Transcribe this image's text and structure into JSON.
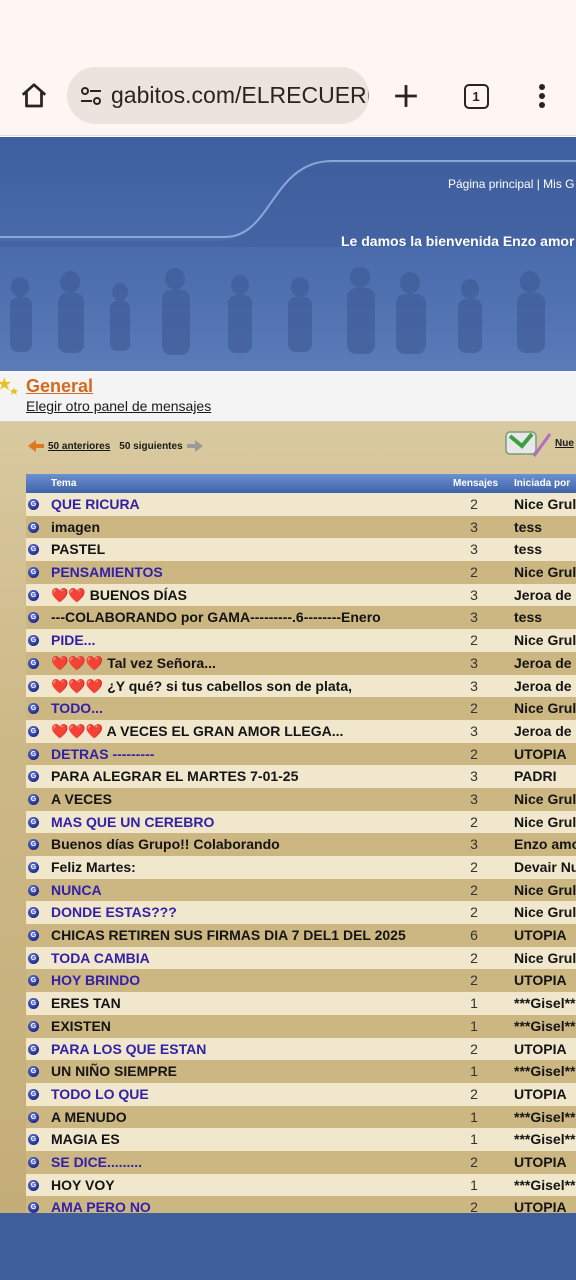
{
  "browser": {
    "url": "gabitos.com/ELRECUERDO",
    "tab_count": "1"
  },
  "site": {
    "nav_links": "Página principal  |  Mis G",
    "welcome": "Le damos la bienvenida Enzo amor d"
  },
  "board": {
    "title": "General",
    "choose_other": "Elegir otro panel de mensajes",
    "prev_label": "50 anteriores",
    "next_label": "50 siguientes",
    "new_topic_label": "Nue"
  },
  "table": {
    "headers": {
      "topic": "Tema",
      "messages": "Mensajes",
      "started_by": "Iniciada por"
    },
    "rows": [
      {
        "hearts": "",
        "title": "QUE RICURA",
        "count": "2",
        "author": "Nice Grull",
        "link": true
      },
      {
        "hearts": "",
        "title": "imagen",
        "count": "3",
        "author": "tess",
        "link": false
      },
      {
        "hearts": "",
        "title": "PASTEL",
        "count": "3",
        "author": "tess",
        "link": false
      },
      {
        "hearts": "",
        "title": "PENSAMIENTOS",
        "count": "2",
        "author": "Nice Grull",
        "link": true
      },
      {
        "hearts": "❤️❤️",
        "title": "BUENOS DÍAS",
        "count": "3",
        "author": "Jeroa de l",
        "link": false
      },
      {
        "hearts": "",
        "title": "---COLABORANDO por GAMA---------.6--------Enero",
        "count": "3",
        "author": "tess",
        "link": false
      },
      {
        "hearts": "",
        "title": "PIDE...",
        "count": "2",
        "author": "Nice Grull",
        "link": true
      },
      {
        "hearts": "❤️❤️❤️",
        "title": "Tal vez Señora...",
        "count": "3",
        "author": "Jeroa de l",
        "link": false
      },
      {
        "hearts": "❤️❤️❤️",
        "title": "¿Y qué? si tus cabellos son de plata,",
        "count": "3",
        "author": "Jeroa de l",
        "link": false
      },
      {
        "hearts": "",
        "title": "TODO...",
        "count": "2",
        "author": "Nice Grull",
        "link": true
      },
      {
        "hearts": "❤️❤️❤️",
        "title": "A VECES EL GRAN AMOR LLEGA...",
        "count": "3",
        "author": "Jeroa de l",
        "link": false
      },
      {
        "hearts": "",
        "title": "DETRAS ---------",
        "count": "2",
        "author": "UTOPIA",
        "link": true
      },
      {
        "hearts": "",
        "title": "PARA ALEGRAR EL MARTES 7-01-25",
        "count": "3",
        "author": "PADRI",
        "link": false
      },
      {
        "hearts": "",
        "title": "A VECES",
        "count": "3",
        "author": "Nice Grull",
        "link": false
      },
      {
        "hearts": "",
        "title": "MAS QUE UN CEREBRO",
        "count": "2",
        "author": "Nice Grull",
        "link": true
      },
      {
        "hearts": "",
        "title": "Buenos días Grupo!! Colaborando",
        "count": "3",
        "author": "Enzo amo",
        "link": false
      },
      {
        "hearts": "",
        "title": "Feliz Martes:",
        "count": "2",
        "author": "Devair Nu",
        "link": false
      },
      {
        "hearts": "",
        "title": "NUNCA",
        "count": "2",
        "author": "Nice Grull",
        "link": true
      },
      {
        "hearts": "",
        "title": "DONDE ESTAS???",
        "count": "2",
        "author": "Nice Grull",
        "link": true
      },
      {
        "hearts": "",
        "title": "CHICAS RETIREN SUS FIRMAS DIA 7 DEL1 DEL 2025",
        "count": "6",
        "author": "UTOPIA",
        "link": false
      },
      {
        "hearts": "",
        "title": "TODA CAMBIA",
        "count": "2",
        "author": "Nice Grull",
        "link": true
      },
      {
        "hearts": "",
        "title": "HOY BRINDO",
        "count": "2",
        "author": "UTOPIA",
        "link": true
      },
      {
        "hearts": "",
        "title": "ERES TAN",
        "count": "1",
        "author": "***Gisel**",
        "link": false
      },
      {
        "hearts": "",
        "title": "EXISTEN",
        "count": "1",
        "author": "***Gisel**",
        "link": false
      },
      {
        "hearts": "",
        "title": "PARA LOS QUE ESTAN",
        "count": "2",
        "author": "UTOPIA",
        "link": true
      },
      {
        "hearts": "",
        "title": "UN NIÑO SIEMPRE",
        "count": "1",
        "author": "***Gisel**",
        "link": false
      },
      {
        "hearts": "",
        "title": "TODO LO QUE",
        "count": "2",
        "author": "UTOPIA",
        "link": true
      },
      {
        "hearts": "",
        "title": "A MENUDO",
        "count": "1",
        "author": "***Gisel**",
        "link": false
      },
      {
        "hearts": "",
        "title": "MAGIA ES",
        "count": "1",
        "author": "***Gisel**",
        "link": false
      },
      {
        "hearts": "",
        "title": "SE DICE.........",
        "count": "2",
        "author": "UTOPIA",
        "link": true
      },
      {
        "hearts": "",
        "title": "HOY VOY",
        "count": "1",
        "author": "***Gisel**",
        "link": false
      },
      {
        "hearts": "",
        "title": "AMA PERO NO",
        "count": "2",
        "author": "UTOPIA",
        "link": true
      }
    ]
  }
}
